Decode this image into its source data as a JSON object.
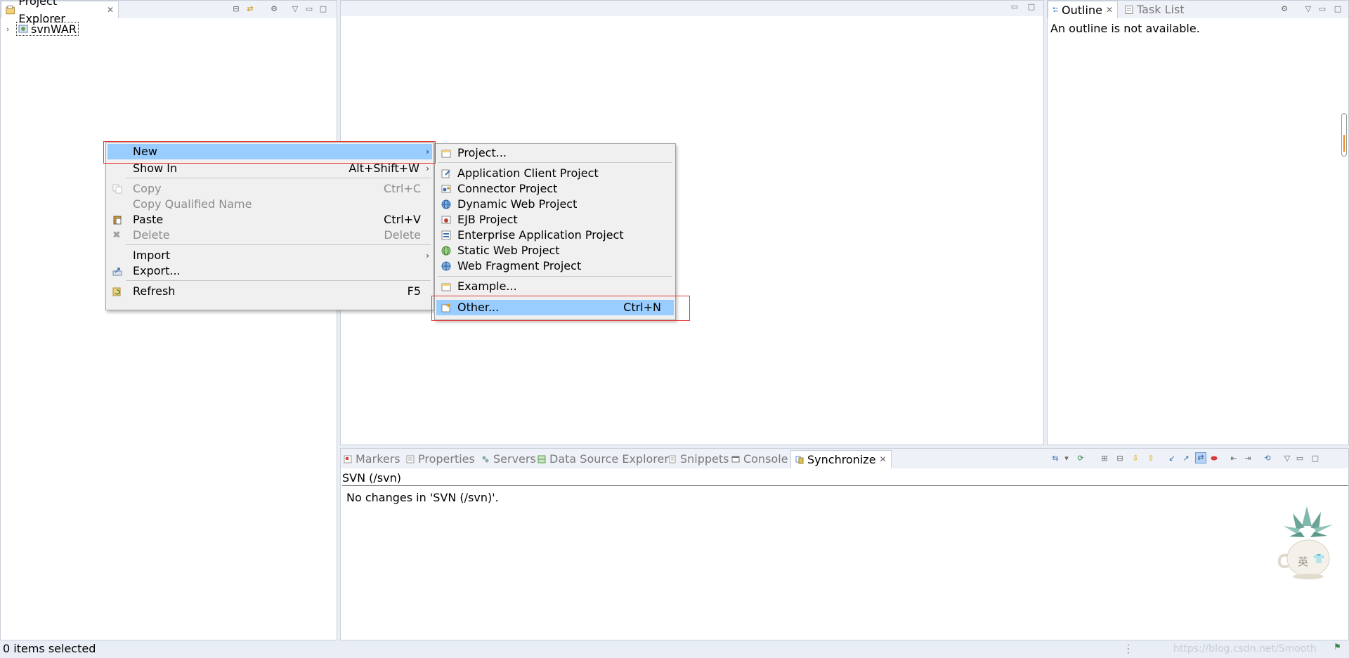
{
  "project_explorer": {
    "tab_title": "Project Explorer",
    "tree": [
      {
        "label": "svnWAR"
      }
    ]
  },
  "outline": {
    "tabs": [
      {
        "label": "Outline"
      },
      {
        "label": "Task List"
      }
    ],
    "message": "An outline is not available."
  },
  "bottom_panel": {
    "tabs": [
      {
        "label": "Markers"
      },
      {
        "label": "Properties"
      },
      {
        "label": "Servers"
      },
      {
        "label": "Data Source Explorer"
      },
      {
        "label": "Snippets"
      },
      {
        "label": "Console"
      },
      {
        "label": "Synchronize"
      }
    ],
    "header": "SVN (/svn)",
    "message": "No changes in 'SVN (/svn)'."
  },
  "context_menu": {
    "items": [
      {
        "label": "New",
        "shortcut": ""
      },
      {
        "label": "Show In",
        "shortcut": "Alt+Shift+W"
      },
      {
        "label": "Copy",
        "shortcut": "Ctrl+C"
      },
      {
        "label": "Copy Qualified Name",
        "shortcut": ""
      },
      {
        "label": "Paste",
        "shortcut": "Ctrl+V"
      },
      {
        "label": "Delete",
        "shortcut": "Delete"
      },
      {
        "label": "Import",
        "shortcut": ""
      },
      {
        "label": "Export...",
        "shortcut": ""
      },
      {
        "label": "Refresh",
        "shortcut": "F5"
      }
    ]
  },
  "new_submenu": {
    "items": [
      {
        "label": "Project...",
        "shortcut": ""
      },
      {
        "label": "Application Client Project",
        "shortcut": ""
      },
      {
        "label": "Connector Project",
        "shortcut": ""
      },
      {
        "label": "Dynamic Web Project",
        "shortcut": ""
      },
      {
        "label": "EJB Project",
        "shortcut": ""
      },
      {
        "label": "Enterprise Application Project",
        "shortcut": ""
      },
      {
        "label": "Static Web Project",
        "shortcut": ""
      },
      {
        "label": "Web Fragment Project",
        "shortcut": ""
      },
      {
        "label": "Example...",
        "shortcut": ""
      },
      {
        "label": "Other...",
        "shortcut": "Ctrl+N"
      }
    ]
  },
  "ime": {
    "char": "英"
  },
  "status_bar": {
    "text": "0 items selected",
    "watermark": "https://blog.csdn.net/Smooth"
  },
  "colors": {
    "highlight": "#99ccff",
    "annotation_red": "#e63a3a",
    "background": "#e9eef6"
  }
}
